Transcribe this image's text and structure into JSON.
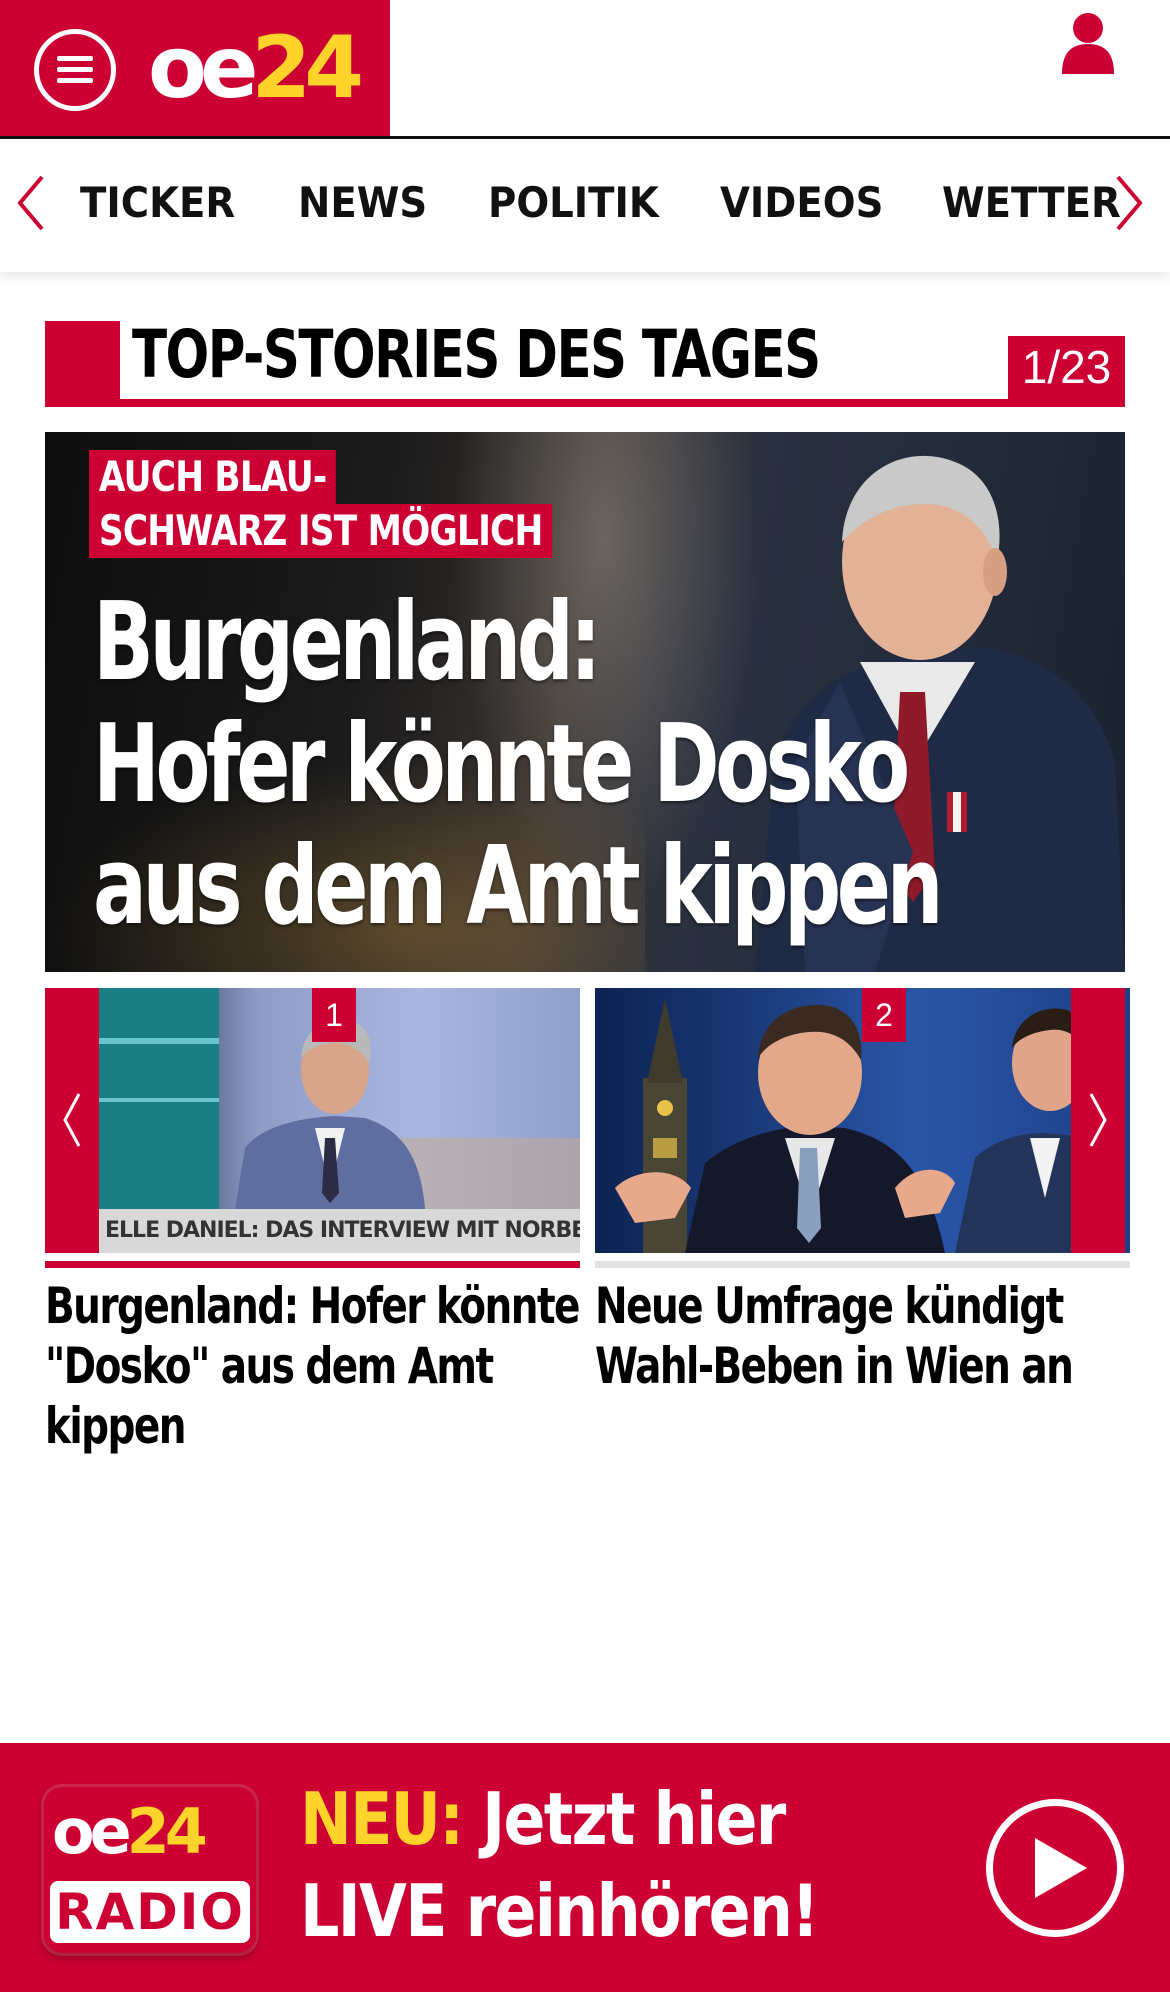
{
  "header": {
    "logo_oe": "oe",
    "logo_num": "24",
    "menu_icon": "hamburger-menu-icon",
    "user_icon": "user-icon",
    "brand_color": "#cc0033",
    "accent_color": "#ffd42a"
  },
  "nav": {
    "items": [
      "TICKER",
      "NEWS",
      "POLITIK",
      "VIDEOS",
      "WETTER"
    ],
    "left_icon": "chevron-left-icon",
    "right_icon": "chevron-right-icon"
  },
  "section": {
    "title": "TOP-STORIES DES TAGES",
    "counter": "1/23"
  },
  "hero": {
    "kicker_line1": "AUCH BLAU-",
    "kicker_line2": "SCHWARZ IST MÖGLICH",
    "headline_line1": "Burgenland:",
    "headline_line2": "Hofer könnte Dosko",
    "headline_line3": "aus dem Amt kippen"
  },
  "teasers": [
    {
      "number": "1",
      "image_caption": "ELLE DANIEL: DAS INTERVIEW MIT NORBERT HOFER",
      "title": "Burgenland: Hofer könnte \"Dosko\" aus dem Amt kippen",
      "active": true
    },
    {
      "number": "2",
      "title": "Neue Umfrage kündigt Wahl-Beben in Wien an",
      "active": false
    }
  ],
  "radio": {
    "logo_oe": "oe",
    "logo_num": "24",
    "logo_label": "RADIO",
    "cta_prefix": "NEU:",
    "cta_line1": "Jetzt hier",
    "cta_line2": "LIVE reinhören!",
    "play_icon": "play-icon"
  }
}
